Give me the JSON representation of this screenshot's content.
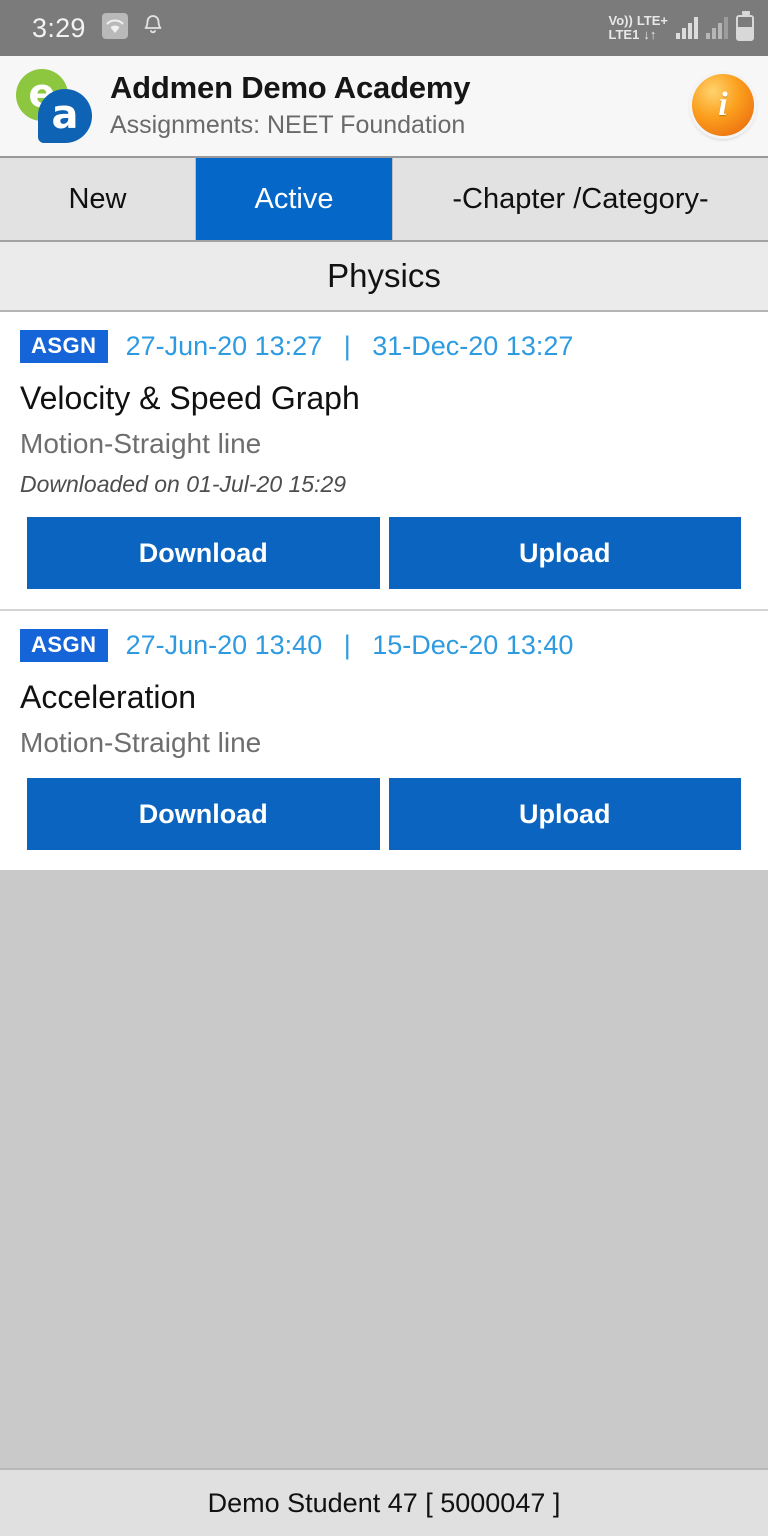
{
  "status_bar": {
    "time": "3:29",
    "wifi_icon": "wifi-icon",
    "notification_icon": "bell-icon",
    "volte_line1": "Vo))",
    "volte_line2": "LTE1",
    "network_label": "LTE+",
    "data_arrows": "↓↑",
    "battery_icon": "battery-icon"
  },
  "header": {
    "logo_e": "e",
    "logo_a": "a",
    "title": "Addmen Demo Academy",
    "subtitle": "Assignments: NEET Foundation",
    "info_icon_label": "i"
  },
  "tabs": [
    {
      "label": "New",
      "selected": false
    },
    {
      "label": "Active",
      "selected": true
    },
    {
      "label": "-Chapter /Category-",
      "selected": false
    }
  ],
  "subject_header": "Physics",
  "assignments": [
    {
      "badge": "ASGN",
      "start_date": "27-Jun-20 13:27",
      "separator": "|",
      "end_date": "31-Dec-20 13:27",
      "title": "Velocity & Speed Graph",
      "chapter": "Motion-Straight line",
      "note": "Downloaded on 01-Jul-20 15:29",
      "download_label": "Download",
      "upload_label": "Upload"
    },
    {
      "badge": "ASGN",
      "start_date": "27-Jun-20 13:40",
      "separator": "|",
      "end_date": "15-Dec-20 13:40",
      "title": "Acceleration",
      "chapter": "Motion-Straight line",
      "note": "",
      "download_label": "Download",
      "upload_label": "Upload"
    }
  ],
  "footer": {
    "student": "Demo Student 47 [ 5000047 ]"
  },
  "colors": {
    "accent_blue": "#0568c8",
    "button_blue": "#0a64c0",
    "badge_blue": "#1565d8",
    "date_blue": "#2e9be0",
    "status_bar_gray": "#7b7b7b",
    "content_gray": "#c9c9c9",
    "footer_gray": "#e0e0e0",
    "logo_green": "#8dc63f",
    "logo_blue": "#0f63b5",
    "info_orange": "#fca01e"
  }
}
